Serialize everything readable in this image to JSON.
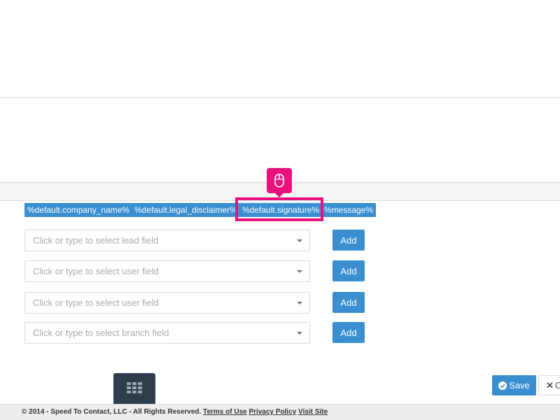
{
  "tags": [
    {
      "label": "%default.company_name%"
    },
    {
      "label": "%default.legal_disclaimer%"
    },
    {
      "label": "%default.signature%"
    },
    {
      "label": "%message%"
    }
  ],
  "fields": [
    {
      "placeholder": "Click or type to select lead field",
      "add_label": "Add"
    },
    {
      "placeholder": "Click or type to select user field",
      "add_label": "Add"
    },
    {
      "placeholder": "Click or type to select user field",
      "add_label": "Add"
    },
    {
      "placeholder": "Click or type to select branch field",
      "add_label": "Add"
    }
  ],
  "actions": {
    "save_label": "Save",
    "cancel_label": "C"
  },
  "footer": {
    "copyright": "© 2014 - Speed To Contact, LLC - All Rights Reserved.",
    "terms_link": "Terms of Use",
    "privacy_link": "Privacy Policy",
    "visit_link": "Visit Site"
  },
  "icons": {
    "marker": "mouse-icon",
    "launcher": "grid-icon",
    "save": "check-circle-icon",
    "cancel": "x-icon",
    "select": "caret-down-icon"
  },
  "colors": {
    "accent": "#3a8fd1",
    "highlight": "#e9117e",
    "launcher": "#2f3d4c"
  }
}
